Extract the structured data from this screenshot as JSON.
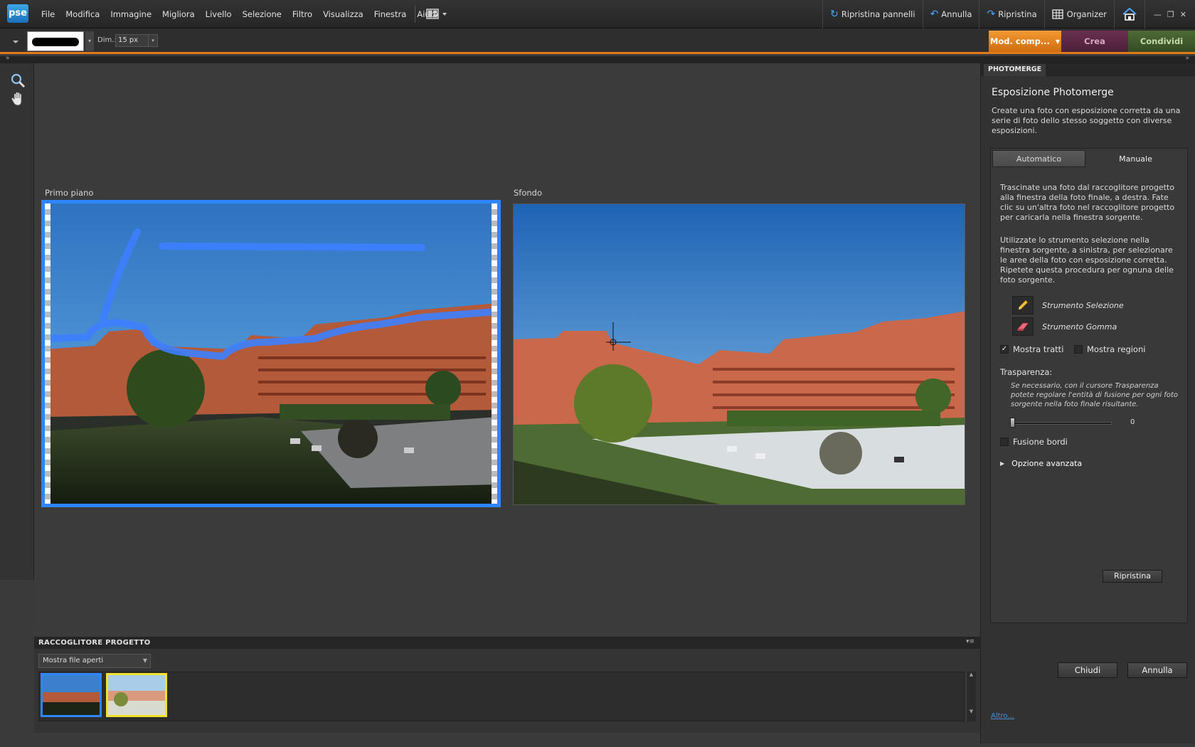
{
  "app": {
    "logo": "pse"
  },
  "menus": [
    "File",
    "Modifica",
    "Immagine",
    "Migliora",
    "Livello",
    "Selezione",
    "Filtro",
    "Visualizza",
    "Finestra",
    "Aiuto"
  ],
  "commands": {
    "reset_panels": "Ripristina pannelli",
    "undo": "Annulla",
    "redo": "Ripristina",
    "organizer": "Organizer"
  },
  "options_bar": {
    "dim_label": "Dim.:",
    "dim_value": "15 px"
  },
  "modes": {
    "edit": "Mod. comp...",
    "create": "Crea",
    "share": "Condividi"
  },
  "workspace": {
    "foreground_label": "Primo piano",
    "background_label": "Sfondo"
  },
  "bin": {
    "title": "RACCOGLITORE PROGETTO",
    "filter": "Mostra file aperti"
  },
  "panel": {
    "tab": "PHOTOMERGE",
    "title": "Esposizione Photomerge",
    "description": "Create una foto con esposizione corretta da una serie di foto dello stesso soggetto con diverse esposizioni.",
    "tab_auto": "Automatico",
    "tab_manual": "Manuale",
    "instructions_1": "Trascinate una foto dal raccoglitore progetto alla finestra della foto finale, a destra. Fate clic su un'altra foto nel raccoglitore progetto per caricarla nella finestra sorgente.",
    "instructions_2": "Utilizzate lo strumento selezione nella finestra sorgente, a sinistra, per selezionare le aree della foto con esposizione corretta. Ripetete questa procedura per ognuna delle foto sorgente.",
    "tool_selection": "Strumento Selezione",
    "tool_eraser": "Strumento Gomma",
    "show_strokes": "Mostra tratti",
    "show_regions": "Mostra regioni",
    "transparency_label": "Trasparenza:",
    "transparency_note": "Se necessario, con il cursore Trasparenza potete regolare l'entità di fusione per ogni foto sorgente nella foto finale risultante.",
    "transparency_value": "0",
    "blend_edges": "Fusione bordi",
    "advanced": "Opzione avanzata",
    "reset": "Ripristina",
    "close": "Chiudi",
    "cancel": "Annulla",
    "more": "Altro..."
  }
}
